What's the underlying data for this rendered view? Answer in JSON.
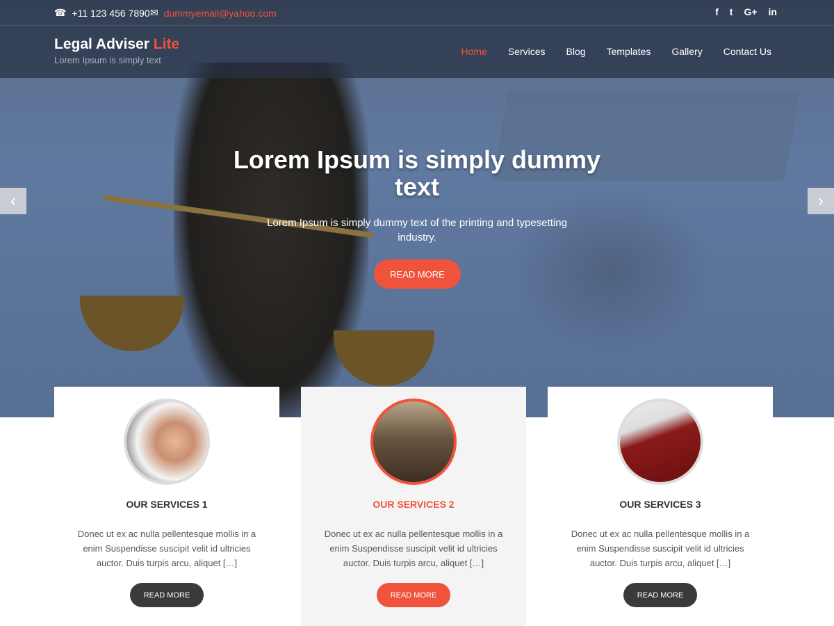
{
  "topbar": {
    "phone": "+11 123 456 7890",
    "email": "dummyemail@yahoo.com",
    "social": [
      "facebook-icon",
      "twitter-icon",
      "google-plus-icon",
      "linkedin-icon"
    ]
  },
  "brand": {
    "name": "Legal Adviser",
    "accent": "Lite",
    "tagline": "Lorem Ipsum is simply text"
  },
  "nav": [
    "Home",
    "Services",
    "Blog",
    "Templates",
    "Gallery",
    "Contact Us"
  ],
  "hero": {
    "title": "Lorem Ipsum is simply dummy text",
    "subtitle": "Lorem Ipsum is simply dummy text of the printing and typesetting industry.",
    "button": "READ MORE"
  },
  "services": [
    {
      "title": "OUR SERVICES 1",
      "text": "Donec ut ex ac nulla pellentesque mollis in a enim Suspendisse suscipit velit id ultricies auctor. Duis turpis arcu, aliquet […]",
      "button": "READ MORE"
    },
    {
      "title": "OUR SERVICES 2",
      "text": "Donec ut ex ac nulla pellentesque mollis in a enim Suspendisse suscipit velit id ultricies auctor. Duis turpis arcu, aliquet […]",
      "button": "READ MORE"
    },
    {
      "title": "OUR SERVICES 3",
      "text": "Donec ut ex ac nulla pellentesque mollis in a enim Suspendisse suscipit velit id ultricies auctor. Duis turpis arcu, aliquet […]",
      "button": "READ MORE"
    }
  ],
  "colors": {
    "accent": "#f0533c",
    "dark_button": "#3a3a3a"
  }
}
